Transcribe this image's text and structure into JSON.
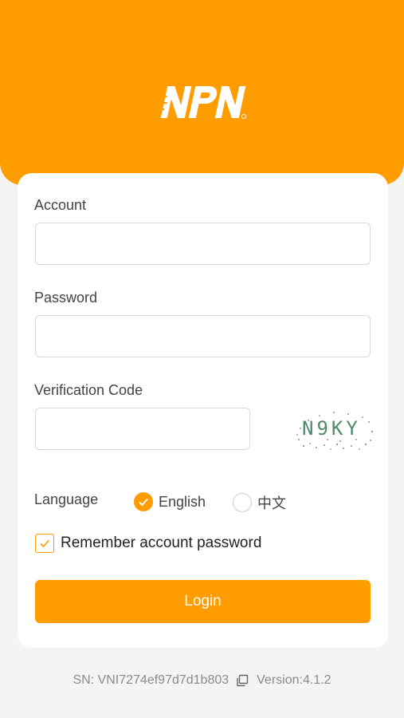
{
  "brand": {
    "logo_text": "NPN",
    "accent_color": "#ff9c00"
  },
  "form": {
    "account": {
      "label": "Account",
      "value": "",
      "placeholder": ""
    },
    "password": {
      "label": "Password",
      "value": "",
      "placeholder": ""
    },
    "verification": {
      "label": "Verification Code",
      "value": "",
      "placeholder": "",
      "captcha_text": "N9KY"
    },
    "language": {
      "label": "Language",
      "options": [
        {
          "label": "English",
          "selected": true
        },
        {
          "label": "中文",
          "selected": false
        }
      ]
    },
    "remember": {
      "label": "Remember account password",
      "checked": true
    },
    "login_label": "Login"
  },
  "footer": {
    "sn": "SN: VNI7274ef97d7d1b803",
    "copy_icon": "copy-icon",
    "version": "Version:4.1.2"
  }
}
